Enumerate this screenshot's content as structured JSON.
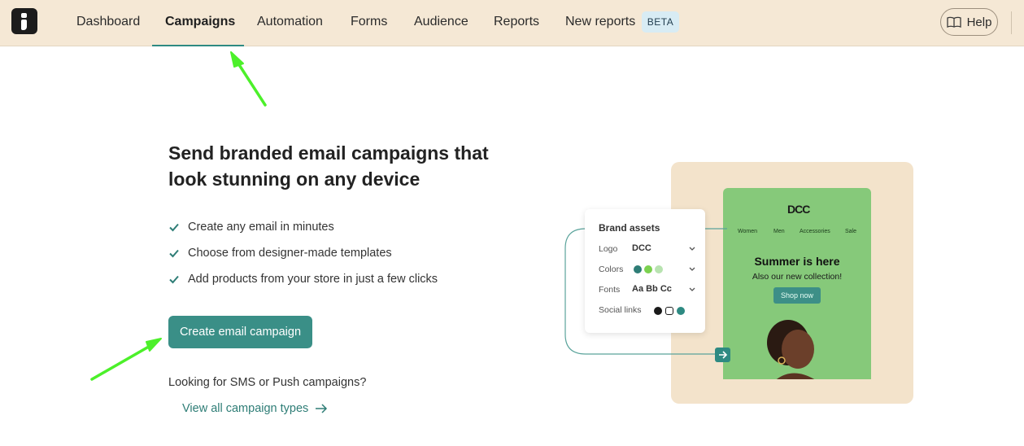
{
  "nav": {
    "items": [
      {
        "label": "Dashboard"
      },
      {
        "label": "Campaigns"
      },
      {
        "label": "Automation"
      },
      {
        "label": "Forms"
      },
      {
        "label": "Audience"
      },
      {
        "label": "Reports"
      },
      {
        "label": "New reports"
      }
    ],
    "active": "Campaigns",
    "beta_label": "BETA",
    "help_label": "Help"
  },
  "hero": {
    "headline": "Send branded email campaigns that look stunning on any device",
    "features": [
      "Create any email in minutes",
      "Choose from designer-made templates",
      "Add products from your store in just a few clicks"
    ],
    "cta_label": "Create email campaign",
    "secondary_question": "Looking for SMS or Push campaigns?",
    "secondary_link": "View all campaign types"
  },
  "illustration": {
    "brand_assets_title": "Brand assets",
    "rows": [
      {
        "label": "Logo",
        "value": "DCC"
      },
      {
        "label": "Colors"
      },
      {
        "label": "Fonts",
        "value": "Aa Bb Cc"
      },
      {
        "label": "Social links"
      }
    ],
    "swatch_colors": [
      "#2e7d76",
      "#7bd14f",
      "#b8e3b0"
    ],
    "email": {
      "logo": "DCC",
      "nav": [
        "Women",
        "Men",
        "Accessories",
        "Sale"
      ],
      "title": "Summer is here",
      "subtitle": "Also our new collection!",
      "button": "Shop now"
    }
  },
  "colors": {
    "nav_bg": "#f5e8d5",
    "accent": "#3a8f87",
    "annotation_arrow": "#4cf02a"
  }
}
